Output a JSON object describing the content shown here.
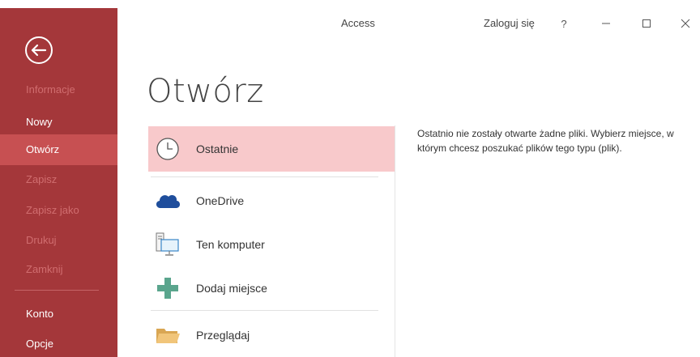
{
  "app": {
    "title": "Access"
  },
  "titlebar": {
    "signin": "Zaloguj się",
    "help": "?"
  },
  "sidebar": {
    "items": [
      {
        "label": "Informacje",
        "state": "disabled"
      },
      {
        "label": "Nowy",
        "state": "enabled"
      },
      {
        "label": "Otwórz",
        "state": "selected"
      },
      {
        "label": "Zapisz",
        "state": "disabled"
      },
      {
        "label": "Zapisz jako",
        "state": "disabled"
      },
      {
        "label": "Drukuj",
        "state": "disabled"
      },
      {
        "label": "Zamknij",
        "state": "disabled"
      },
      {
        "label": "Konto",
        "state": "enabled"
      },
      {
        "label": "Opcje",
        "state": "enabled"
      }
    ]
  },
  "page": {
    "title": "Otwórz"
  },
  "places": [
    {
      "label": "Ostatnie",
      "icon": "clock-icon"
    },
    {
      "label": "OneDrive",
      "icon": "cloud-icon"
    },
    {
      "label": "Ten komputer",
      "icon": "computer-icon"
    },
    {
      "label": "Dodaj miejsce",
      "icon": "plus-icon"
    },
    {
      "label": "Przeglądaj",
      "icon": "folder-icon"
    }
  ],
  "info": {
    "message": "Ostatnio nie zostały otwarte żadne pliki. Wybierz miejsce, w którym chcesz poszukać plików tego typu (plik)."
  },
  "colors": {
    "sidebar": "#a4373a",
    "selected_nav": "#c75052",
    "selected_place": "#f8c9cb",
    "onedrive_blue": "#1f4e9c",
    "plus_green": "#5aa58d",
    "folder": "#e9b86a"
  }
}
